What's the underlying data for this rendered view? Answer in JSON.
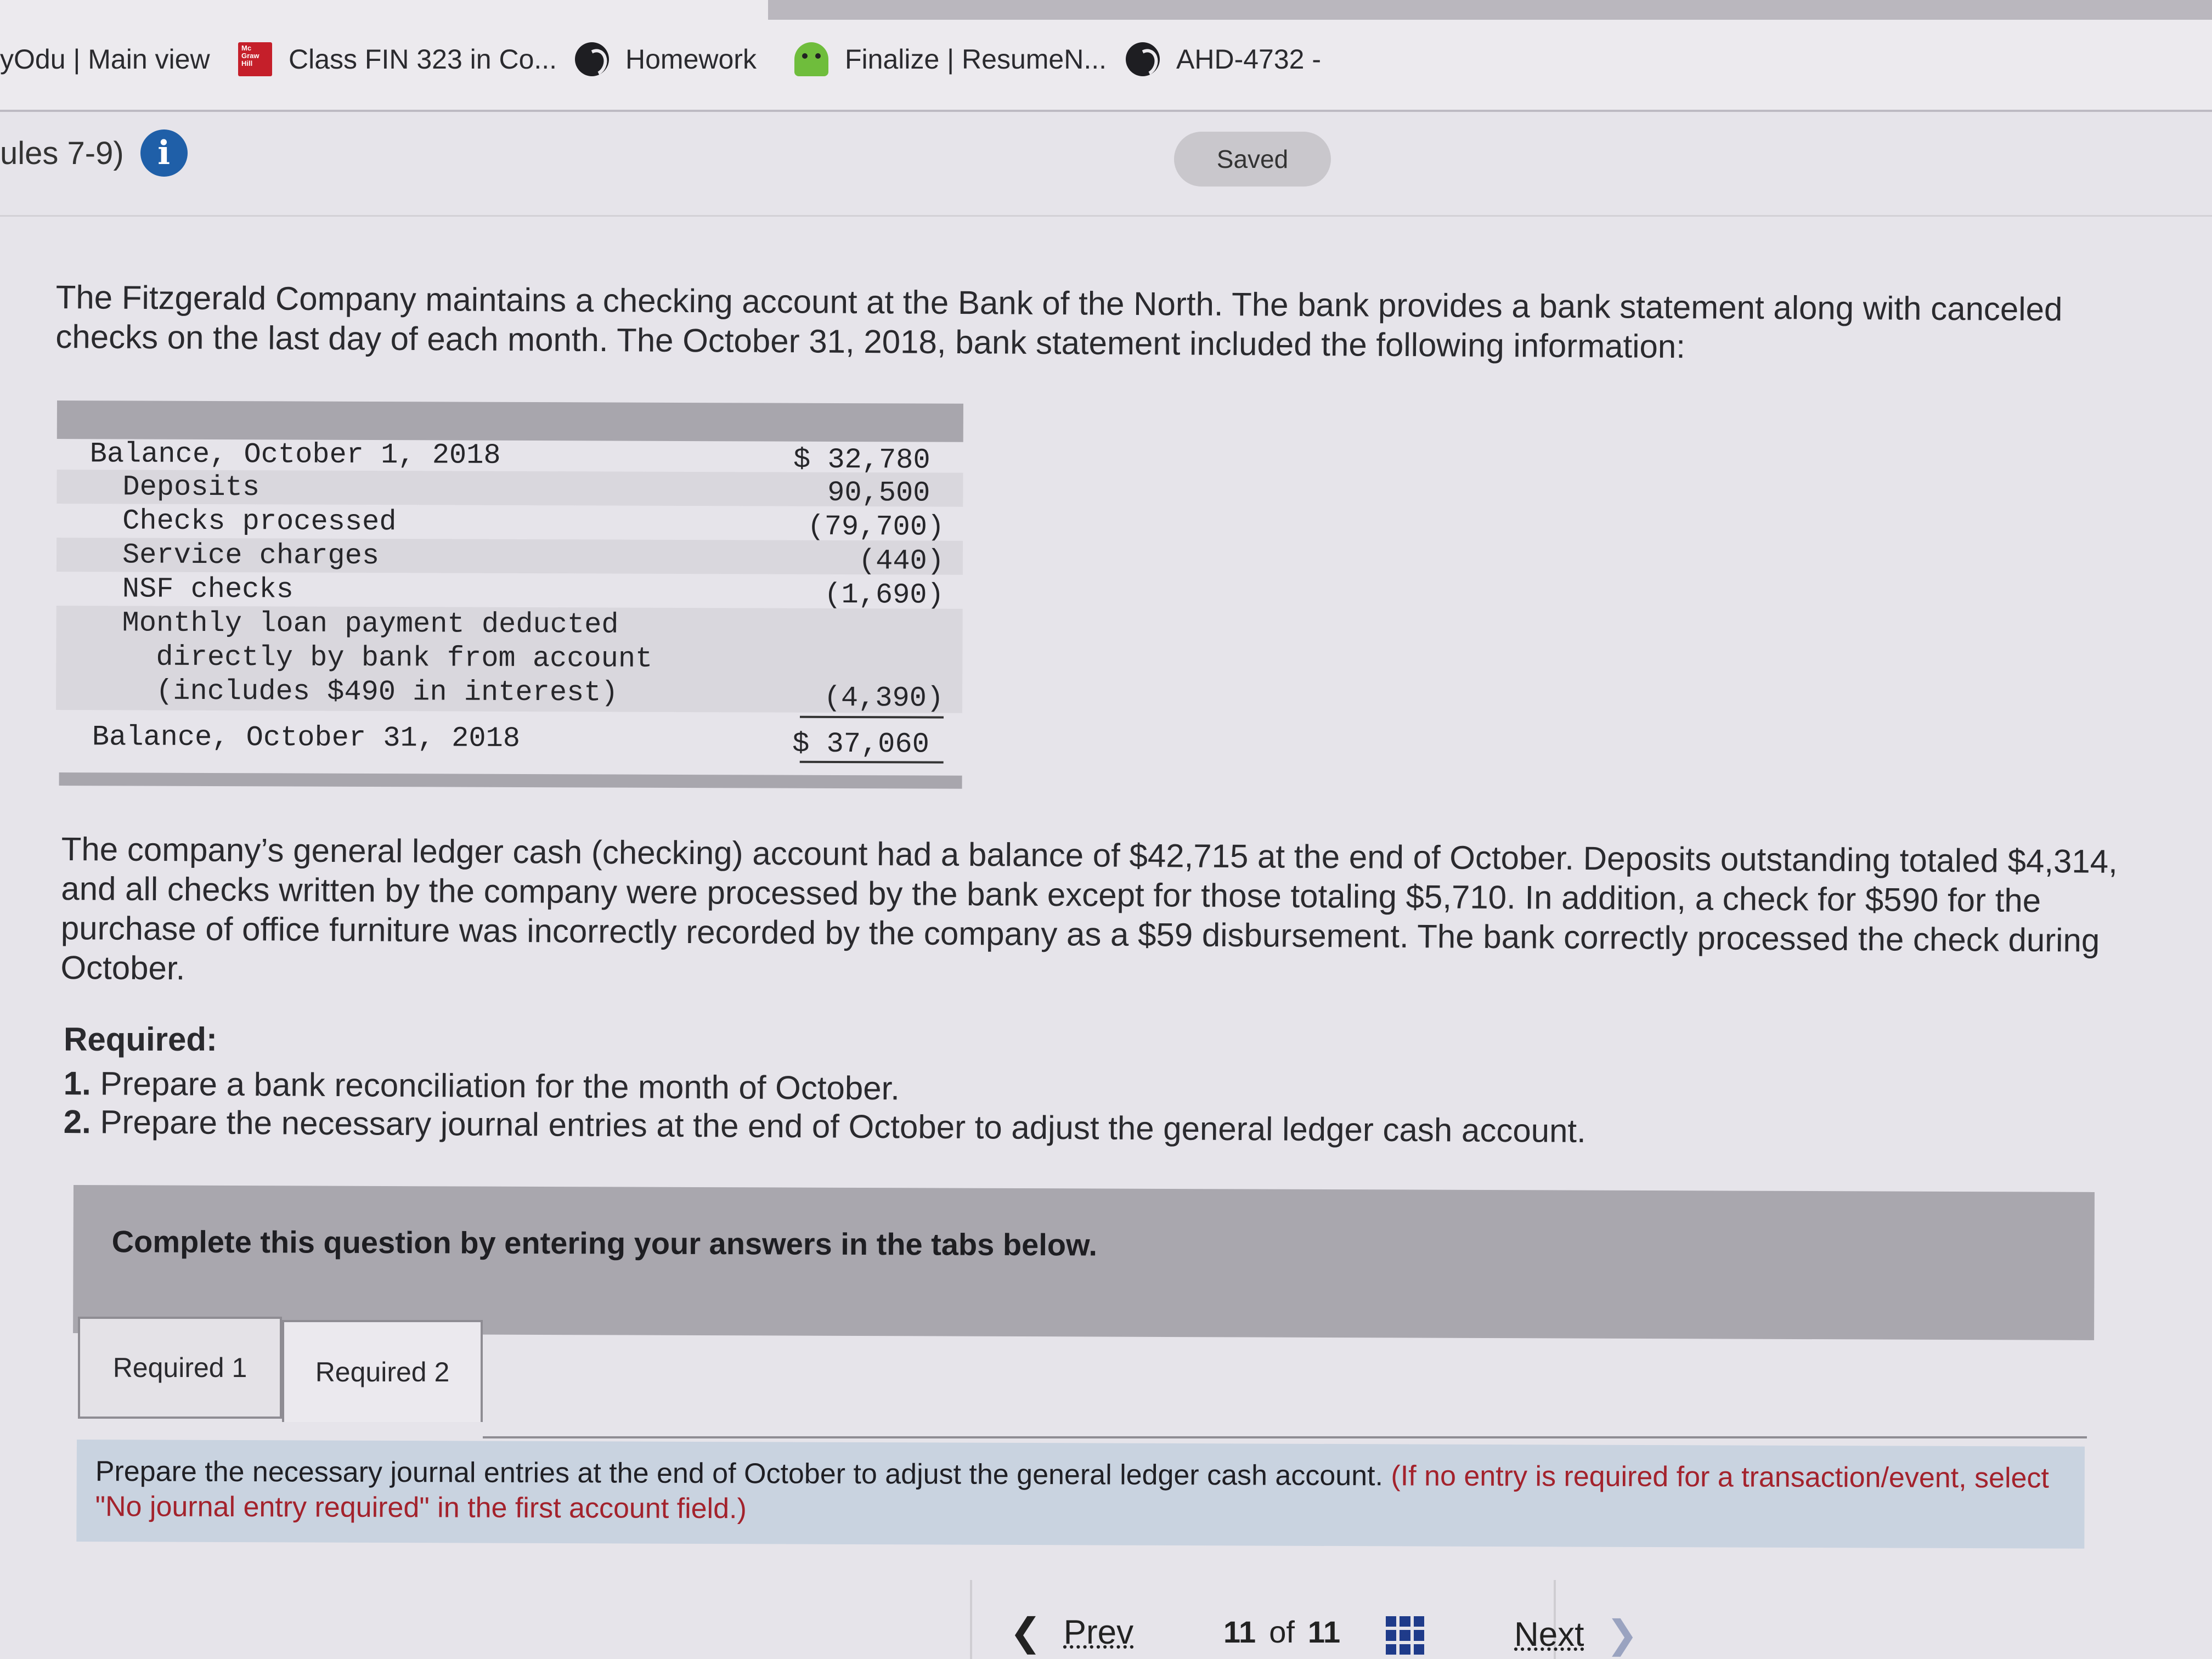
{
  "browser": {
    "bookmarks": [
      {
        "label": "yOdu | Main view",
        "icon": "none"
      },
      {
        "label": "Class FIN 323 in Co...",
        "icon": "mcgraw-hill-icon"
      },
      {
        "label": "Homework",
        "icon": "globe-icon"
      },
      {
        "label": "Finalize | ResumeN...",
        "icon": "robot-icon"
      },
      {
        "label": "AHD-4732 -",
        "icon": "globe-icon"
      }
    ]
  },
  "header": {
    "title": "ules 7-9)",
    "info_glyph": "i",
    "saved_label": "Saved"
  },
  "question": {
    "intro": "The Fitzgerald Company maintains a checking account at the Bank of the North. The bank provides a bank statement along with canceled checks on the last day of each month. The October 31, 2018, bank statement included the following information:",
    "statement": [
      {
        "label": "Balance, October 1, 2018",
        "value": "$ 32,780"
      },
      {
        "label": "Deposits",
        "value": "90,500"
      },
      {
        "label": "Checks processed",
        "value": "(79,700)"
      },
      {
        "label": "Service charges",
        "value": "(440)"
      },
      {
        "label": "NSF checks",
        "value": "(1,690)"
      },
      {
        "label": "Monthly loan payment deducted",
        "value": ""
      },
      {
        "label": "directly by bank from account",
        "value": ""
      },
      {
        "label": "(includes $490 in interest)",
        "value": "(4,390)"
      },
      {
        "label": "Balance, October 31, 2018",
        "value": "$ 37,060"
      }
    ],
    "details": "The company’s general ledger cash (checking) account had a balance of $42,715 at the end of October. Deposits outstanding totaled $4,314, and all checks written by the company were processed by the bank except for those totaling $5,710. In addition, a check for $590 for the purchase of office furniture was incorrectly recorded by the company as a $59 disbursement. The bank correctly processed the check during October.",
    "required_heading": "Required:",
    "required_items": [
      {
        "num": "1.",
        "text": "Prepare a bank reconciliation for the month of October."
      },
      {
        "num": "2.",
        "text": "Prepare the necessary journal entries at the end of October to adjust the general ledger cash account."
      }
    ]
  },
  "answer_panel": {
    "prompt": "Complete this question by entering your answers in the tabs below.",
    "tabs": [
      {
        "label": "Required 1",
        "active": false
      },
      {
        "label": "Required 2",
        "active": true
      }
    ],
    "instruction": "Prepare the necessary journal entries at the end of October to adjust the general ledger cash account.",
    "instruction_note": "(If no entry is required for a transaction/event, select \"No journal entry required\" in the first account field.)"
  },
  "footer": {
    "prev_label": "Prev",
    "current_page": "11",
    "of_label": "of",
    "total_pages": "11",
    "next_label": "Next"
  },
  "colors": {
    "info_icon": "#1f5fa8",
    "note_red": "#a3222c",
    "grid_icon": "#1f3b8a"
  }
}
